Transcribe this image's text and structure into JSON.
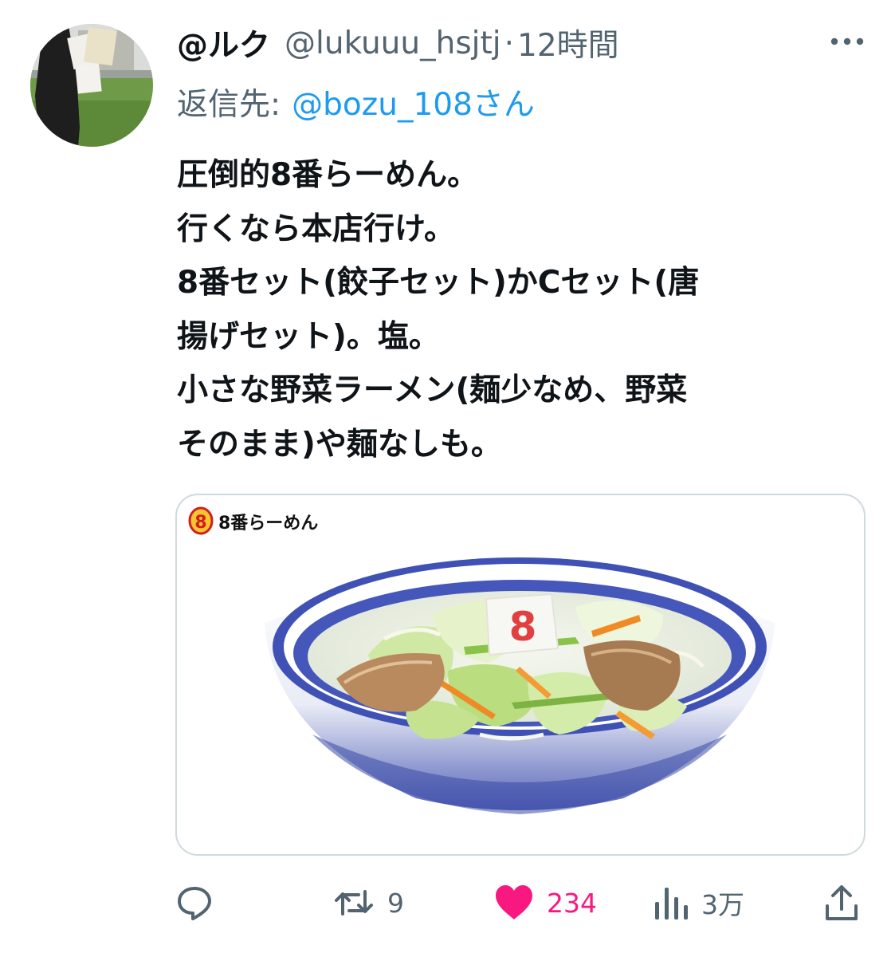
{
  "tweet": {
    "display_name": "@ルク",
    "handle": "@lukuuu_hsjtj",
    "separator": "·",
    "time": "12時間",
    "reply_prefix": "返信先:",
    "reply_target": "@bozu_108さん",
    "lines": [
      "圧倒的8番らーめん。",
      "行くなら本店行け。",
      "8番セット(餃子セット)かCセット(唐",
      "揚げセット)。塩。",
      "小さな野菜ラーメン(麺少なめ、野菜",
      "そのまま)や麺なしも。"
    ]
  },
  "media": {
    "logo_text": "8番らーめん",
    "logo_mark": "8",
    "kamaboko_mark": "8"
  },
  "actions": {
    "reply_count": "",
    "retweet_count": "9",
    "like_count": "234",
    "views_count": "3万"
  },
  "colors": {
    "text": "#0f1419",
    "secondary": "#536471",
    "link": "#1d9bf0",
    "like": "#f91880",
    "border": "#cfd9de"
  },
  "icons": {
    "more": "more-dots-icon",
    "reply": "reply-bubble-icon",
    "retweet": "retweet-icon",
    "like": "heart-icon",
    "views": "views-bar-chart-icon",
    "share": "share-upload-icon"
  }
}
